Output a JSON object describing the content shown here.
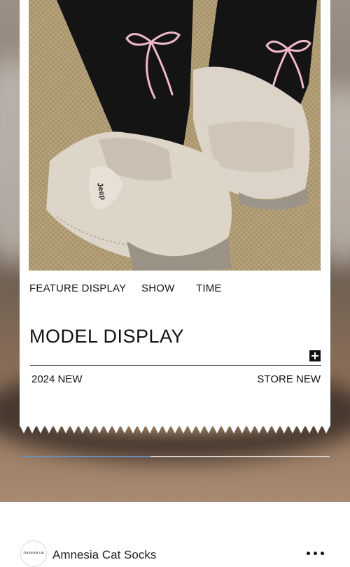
{
  "feature_tabs": [
    "FEATURE DISPLAY",
    "SHOW",
    "TIME"
  ],
  "section_title": "MODEL DISPLAY",
  "meta": {
    "year_label": "2024 NEW",
    "store_label": "STORE NEW"
  },
  "photo": {
    "brand_mark": "Jeep"
  },
  "gallery": {
    "progress_fraction": 0.42
  },
  "store": {
    "logo_text": "Amnesia cat",
    "name": "Amnesia Cat Socks"
  },
  "icons": {
    "expand": "plus-icon",
    "more": "more-dots-icon"
  },
  "colors": {
    "accent": "#6a8fb5",
    "text": "#111111",
    "card": "#ffffff"
  }
}
